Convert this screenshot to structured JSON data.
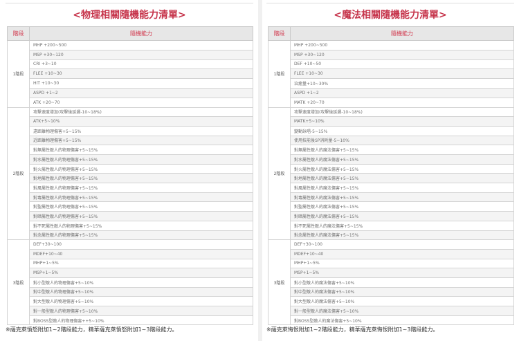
{
  "physical": {
    "title": "<物理相關隨機能力清單>",
    "header_stage": "階段",
    "header_ability": "隨機能力",
    "groups": [
      {
        "stage": "1階段",
        "items": [
          "MHP +200~500",
          "MSP +30~120",
          "CRI +3~10",
          "FLEE +10~30",
          "HIT +10~30",
          "ASPD +1~2",
          "ATK +20~70"
        ]
      },
      {
        "stage": "2階段",
        "items": [
          "攻擊速度增加(攻擊後延遲-10~18%)",
          "ATK+5~10%",
          "遠距離物理傷害+5~15%",
          "近距離物理傷害+5~15%",
          "對無屬性敵人的物理傷害+5~15%",
          "對水屬性敵人的物理傷害+5~15%",
          "對火屬性敵人的物理傷害+5~15%",
          "對地屬性敵人的物理傷害+5~15%",
          "對風屬性敵人的物理傷害+5~15%",
          "對毒屬性敵人的物理傷害+5~15%",
          "對聖屬性敵人的物理傷害+5~15%",
          "對暗屬性敵人的物理傷害+5~15%",
          "對不死屬性敵人的物理傷害+5~15%",
          "對念屬性敵人的物理傷害+5~15%"
        ]
      },
      {
        "stage": "3階段",
        "items": [
          "DEF+30~100",
          "MDEF+10~40",
          "MHP+1~5%",
          "MSP+1~5%",
          "對小型敵人的物理傷害+5~10%",
          "對中型敵人的物理傷害+5~10%",
          "對大型敵人的物理傷害+5~10%",
          "對一般型敵人的物理傷害+5~10%",
          "對BOSS型敵人的物理傷害++5~10%"
        ]
      }
    ],
    "footnote": "※薩克萊憤怒附加1~2階段能力，精華薩克萊憤怒附加1~3階段能力。"
  },
  "magic": {
    "title": "<魔法相關隨機能力清單>",
    "header_stage": "階段",
    "header_ability": "隨機能力",
    "groups": [
      {
        "stage": "1階段",
        "items": [
          "MHP +200~500",
          "MSP +30~120",
          "DEF +10~50",
          "FLEE +10~30",
          "治癒量+10~30%",
          "ASPD +1~2",
          "MATK +20~70"
        ]
      },
      {
        "stage": "2階段",
        "items": [
          "攻擊速度增加(攻擊後延遲-10~18%)",
          "MATK+5~10%",
          "變動詠唱-5~15%",
          "使用技能後SP消耗量-5~10%",
          "對無屬性敵人的魔法傷害+5~15%",
          "對水屬性敵人的魔法傷害+5~15%",
          "對火屬性敵人的魔法傷害+5~15%",
          "對地屬性敵人的魔法傷害+5~15%",
          "對風屬性敵人的魔法傷害+5~15%",
          "對毒屬性敵人的魔法傷害+5~15%",
          "對聖屬性敵人的魔法傷害+5~15%",
          "對暗屬性敵人的魔法傷害+5~15%",
          "對不死屬性敵人的魔法傷害+5~15%",
          "對念屬性敵人的魔法傷害+5~15%"
        ]
      },
      {
        "stage": "3階段",
        "items": [
          "DEF+30~100",
          "MDEF+10~40",
          "MHP+1~5%",
          "MSP+1~5%",
          "對小型敵人的魔法傷害+5~10%",
          "對中型敵人的魔法傷害+5~10%",
          "對大型敵人的魔法傷害+5~10%",
          "對一般型敵人的魔法傷害+5~10%",
          "對BOSS型敵人的魔法傷害+5~10%"
        ]
      }
    ],
    "footnote": "※薩克萊悔恨附加1~2階段能力，精華薩克萊悔恨附加1~3階段能力。"
  }
}
